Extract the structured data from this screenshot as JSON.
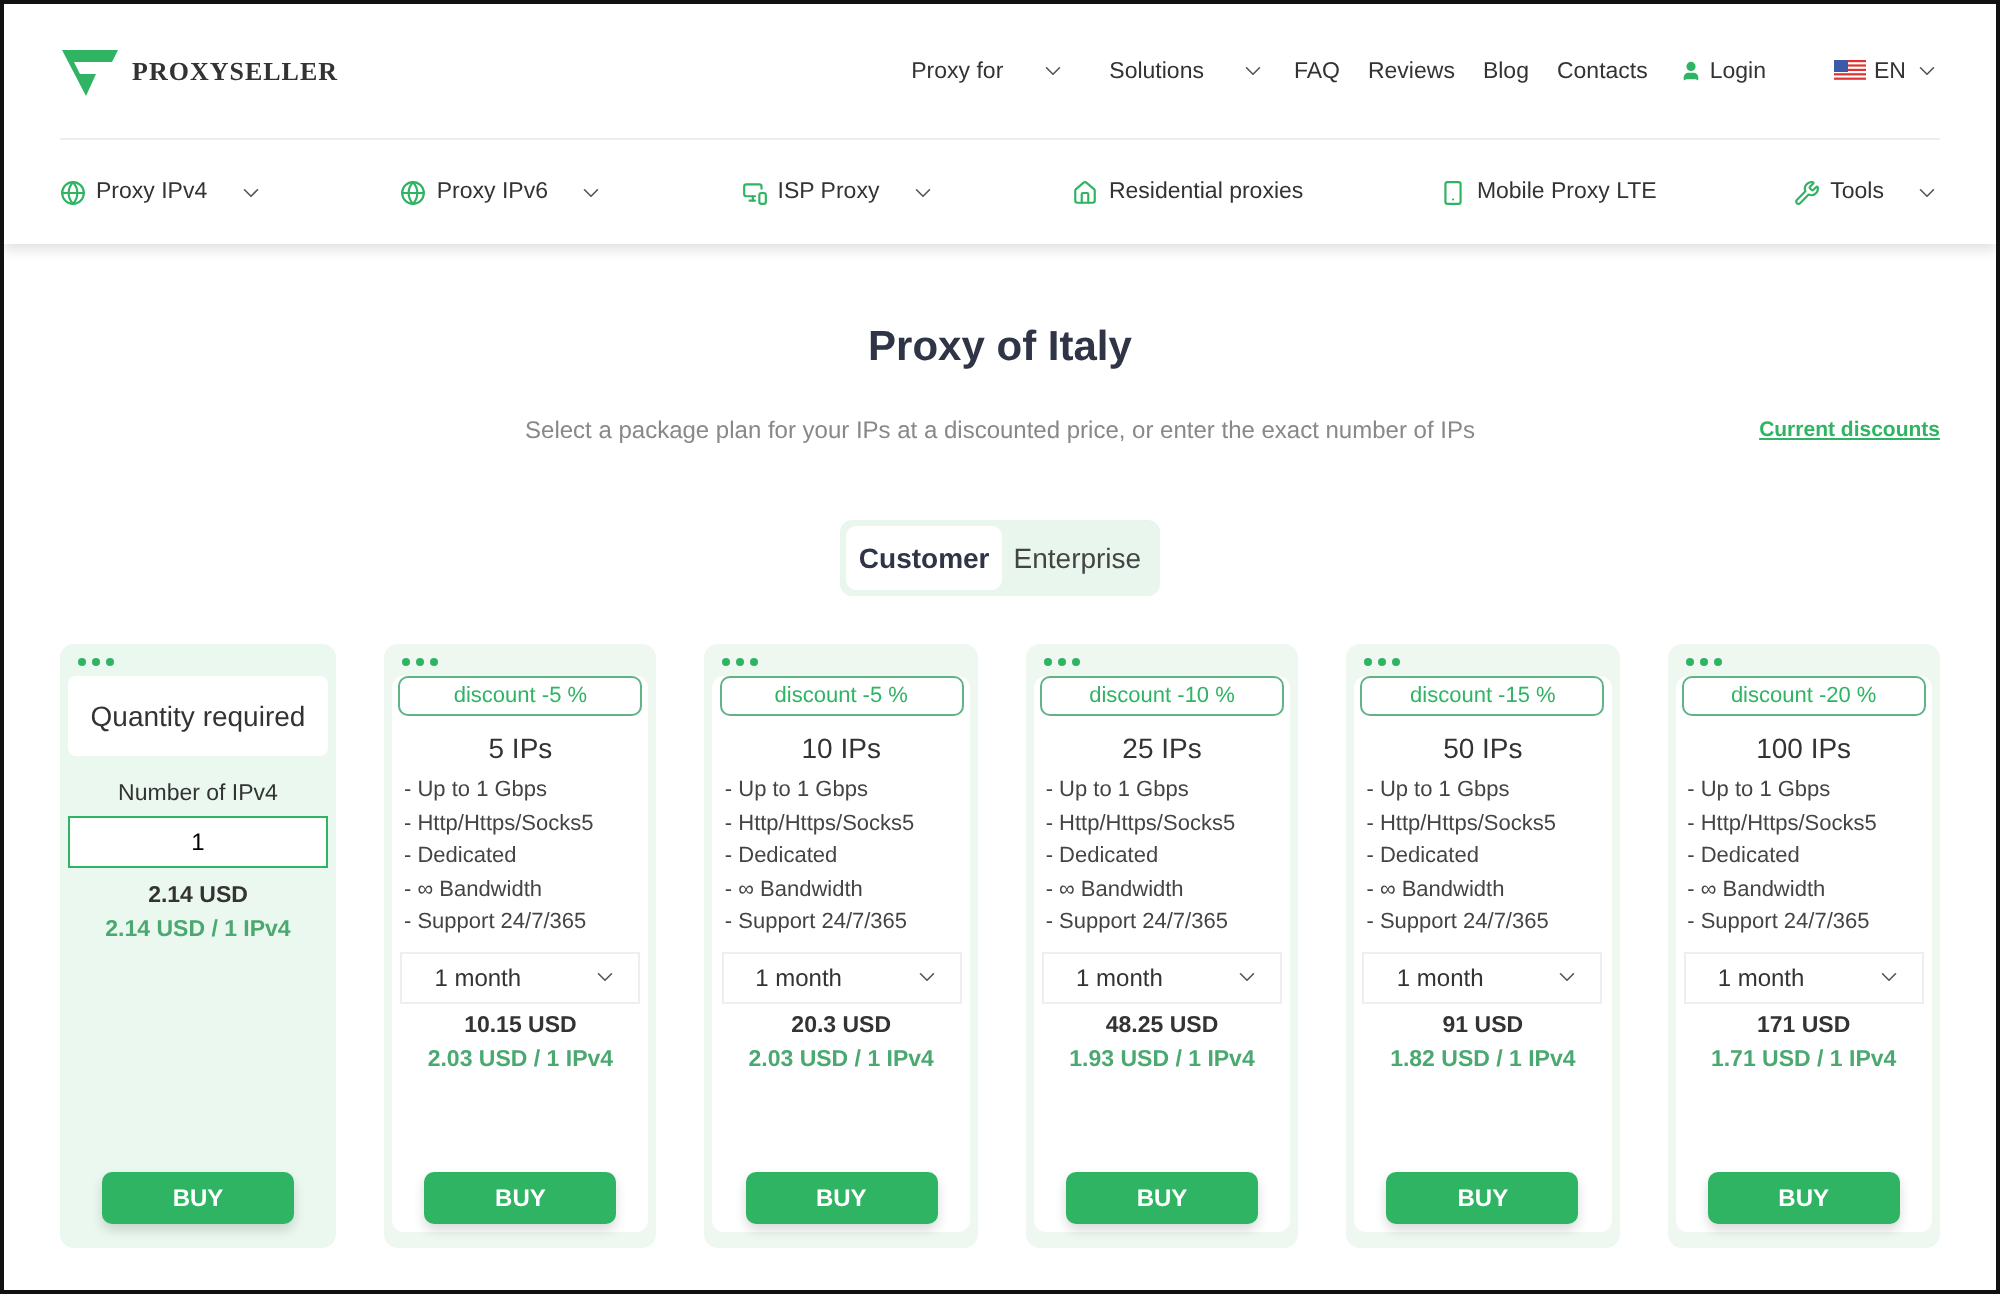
{
  "brand": {
    "name": "PROXYSELLER"
  },
  "top_nav": [
    {
      "label": "Proxy for",
      "dropdown": true,
      "kind": "link"
    },
    {
      "label": "Solutions",
      "dropdown": true,
      "kind": "link"
    },
    {
      "label": "FAQ",
      "dropdown": false,
      "kind": "link"
    },
    {
      "label": "Reviews",
      "dropdown": false,
      "kind": "link"
    },
    {
      "label": "Blog",
      "dropdown": false,
      "kind": "link"
    },
    {
      "label": "Contacts",
      "dropdown": false,
      "kind": "link"
    },
    {
      "label": "Login",
      "dropdown": false,
      "kind": "login"
    },
    {
      "label": "EN",
      "dropdown": true,
      "kind": "language"
    }
  ],
  "product_nav": [
    {
      "label": "Proxy IPv4",
      "dropdown": true,
      "kind": "globe"
    },
    {
      "label": "Proxy IPv6",
      "dropdown": true,
      "kind": "globe"
    },
    {
      "label": "ISP Proxy",
      "dropdown": true,
      "kind": "monitor"
    },
    {
      "label": "Residential proxies",
      "dropdown": false,
      "kind": "house"
    },
    {
      "label": "Mobile Proxy LTE",
      "dropdown": false,
      "kind": "phone"
    },
    {
      "label": "Tools",
      "dropdown": true,
      "kind": "tools"
    }
  ],
  "title": "Proxy of Italy",
  "subtitle": "Select a package plan for your IPs at a discounted price, or enter the exact number of IPs",
  "discounts_link": "Current discounts",
  "tabs": [
    {
      "label": "Customer",
      "selected": true
    },
    {
      "label": "Enterprise",
      "selected": false
    }
  ],
  "custom_card": {
    "heading": "Quantity required",
    "field_label": "Number of IPv4",
    "value": "1",
    "total": "2.14 USD",
    "unit_price": "2.14 USD / 1 IPv4",
    "button": "BUY"
  },
  "plans": [
    {
      "discount": "discount -5 %",
      "name": "5 IPs",
      "features": [
        "- Up to 1 Gbps",
        "- Http/Https/Socks5",
        "- Dedicated",
        "- ∞ Bandwidth",
        "- Support 24/7/365"
      ],
      "period": "1 month",
      "total": "10.15 USD",
      "unit_price": "2.03 USD / 1 IPv4",
      "button": "BUY"
    },
    {
      "discount": "discount -5 %",
      "name": "10 IPs",
      "features": [
        "- Up to 1 Gbps",
        "- Http/Https/Socks5",
        "- Dedicated",
        "- ∞ Bandwidth",
        "- Support 24/7/365"
      ],
      "period": "1 month",
      "total": "20.3 USD",
      "unit_price": "2.03 USD / 1 IPv4",
      "button": "BUY"
    },
    {
      "discount": "discount -10 %",
      "name": "25 IPs",
      "features": [
        "- Up to 1 Gbps",
        "- Http/Https/Socks5",
        "- Dedicated",
        "- ∞ Bandwidth",
        "- Support 24/7/365"
      ],
      "period": "1 month",
      "total": "48.25 USD",
      "unit_price": "1.93 USD / 1 IPv4",
      "button": "BUY"
    },
    {
      "discount": "discount -15 %",
      "name": "50 IPs",
      "features": [
        "- Up to 1 Gbps",
        "- Http/Https/Socks5",
        "- Dedicated",
        "- ∞ Bandwidth",
        "- Support 24/7/365"
      ],
      "period": "1 month",
      "total": "91 USD",
      "unit_price": "1.82 USD / 1 IPv4",
      "button": "BUY"
    },
    {
      "discount": "discount -20 %",
      "name": "100 IPs",
      "features": [
        "- Up to 1 Gbps",
        "- Http/Https/Socks5",
        "- Dedicated",
        "- ∞ Bandwidth",
        "- Support 24/7/365"
      ],
      "period": "1 month",
      "total": "171 USD",
      "unit_price": "1.71 USD / 1 IPv4",
      "button": "BUY"
    }
  ]
}
